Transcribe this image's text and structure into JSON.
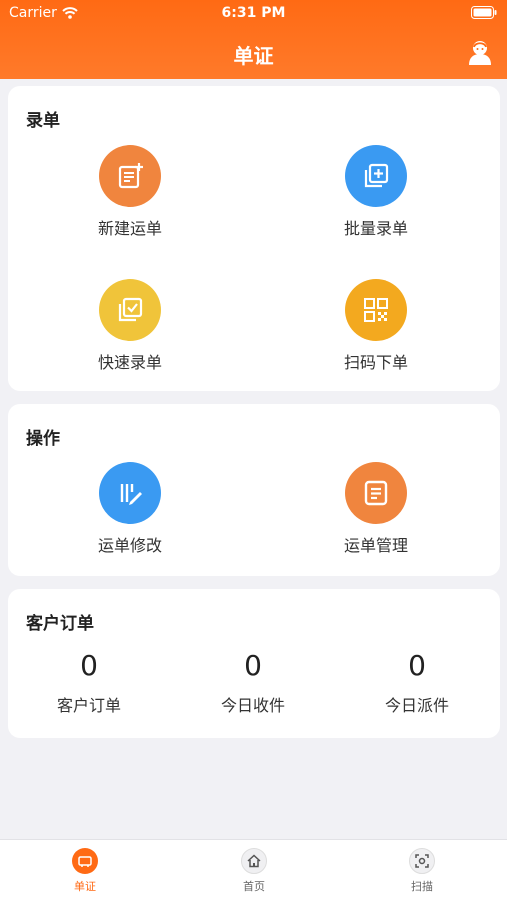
{
  "status": {
    "carrier": "Carrier",
    "time": "6:31 PM"
  },
  "header": {
    "title": "单证"
  },
  "sections": {
    "entry": {
      "title": "录单",
      "items": [
        {
          "label": "新建运单",
          "color": "#f0853e"
        },
        {
          "label": "批量录单",
          "color": "#3a9af2"
        },
        {
          "label": "快速录单",
          "color": "#f0c43a"
        },
        {
          "label": "扫码下单",
          "color": "#f3a91f"
        }
      ]
    },
    "operation": {
      "title": "操作",
      "items": [
        {
          "label": "运单修改",
          "color": "#3a9af2"
        },
        {
          "label": "运单管理",
          "color": "#f0853e"
        }
      ]
    },
    "customer": {
      "title": "客户订单",
      "stats": [
        {
          "value": "0",
          "label": "客户订单"
        },
        {
          "value": "0",
          "label": "今日收件"
        },
        {
          "value": "0",
          "label": "今日派件"
        }
      ]
    }
  },
  "tabbar": {
    "tabs": [
      {
        "label": "单证",
        "active": true
      },
      {
        "label": "首页",
        "active": false
      },
      {
        "label": "扫描",
        "active": false
      }
    ]
  },
  "colors": {
    "accent": "#ff6a14",
    "page_bg": "#f1f1f5"
  }
}
